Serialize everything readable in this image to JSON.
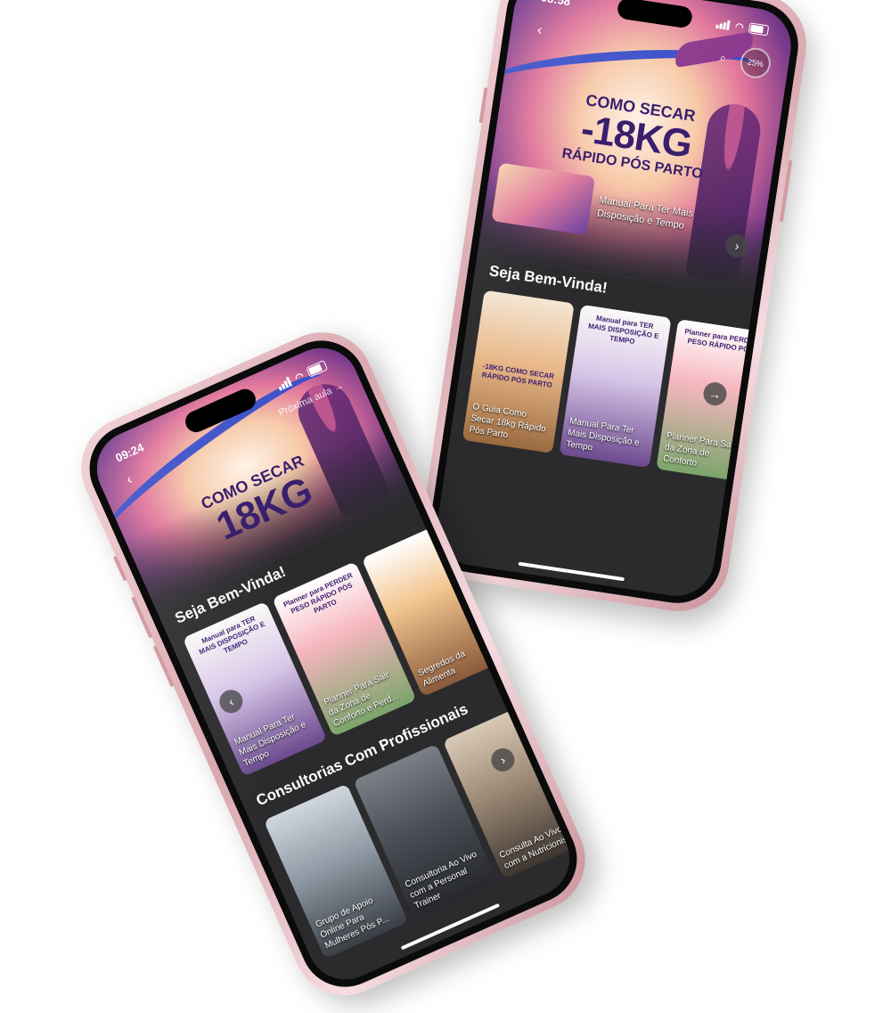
{
  "phone_back": {
    "status": {
      "time": "08:58"
    },
    "hero": {
      "line1": "COMO SECAR",
      "line2": "-18KG",
      "line3": "RÁPIDO PÓS PARTO",
      "progress": "25%",
      "next_title": "Manual Para Ter Mais Disposição e Tempo"
    },
    "welcome_title": "Seja Bem-Vinda!",
    "cards": [
      {
        "label": "O Guia Como Secar 18kg Rápido Pós Parto",
        "badge": "-18KG COMO SECAR RÁPIDO PÓS PARTO"
      },
      {
        "label": "Manual Para Ter Mais Disposição e Tempo",
        "badge": "Manual para TER MAIS DISPOSIÇÃO E TEMPO"
      },
      {
        "label": "Planner Para Sair da Zona de Conforto",
        "badge": "Planner para PERDER PESO RÁPIDO PÓS"
      }
    ]
  },
  "phone_front": {
    "status": {
      "time": "09:24"
    },
    "hero": {
      "line1": "COMO SECAR",
      "line2": "18KG",
      "next_label": "Próxima aula"
    },
    "welcome_title": "Seja Bem-Vinda!",
    "cards": [
      {
        "label": "Manual Para Ter Mais Disposição e Tempo",
        "badge": "Manual para TER MAIS DISPOSIÇÃO E TEMPO"
      },
      {
        "label": "Planner Para Sair da Zona de Conforto e Perd...",
        "badge": "Planner para PERDER PESO RÁPIDO PÓS PARTO"
      },
      {
        "label": "Segredos da Alimenta",
        "badge": ""
      }
    ],
    "consult_title": "Consultorias Com Profissionais",
    "consult_cards": [
      {
        "label": "Grupo de Apoio Online Para Mulheres Pós P..."
      },
      {
        "label": "Consultoria Ao Vivo com a Personal Trainer"
      },
      {
        "label": "Consulta Ao Vivo com a Nutricionista"
      }
    ]
  },
  "icons": [
    "back-arrow-icon",
    "search-icon",
    "chevron-right-icon",
    "chevron-left-icon",
    "signal-icon",
    "wifi-icon",
    "battery-icon"
  ]
}
